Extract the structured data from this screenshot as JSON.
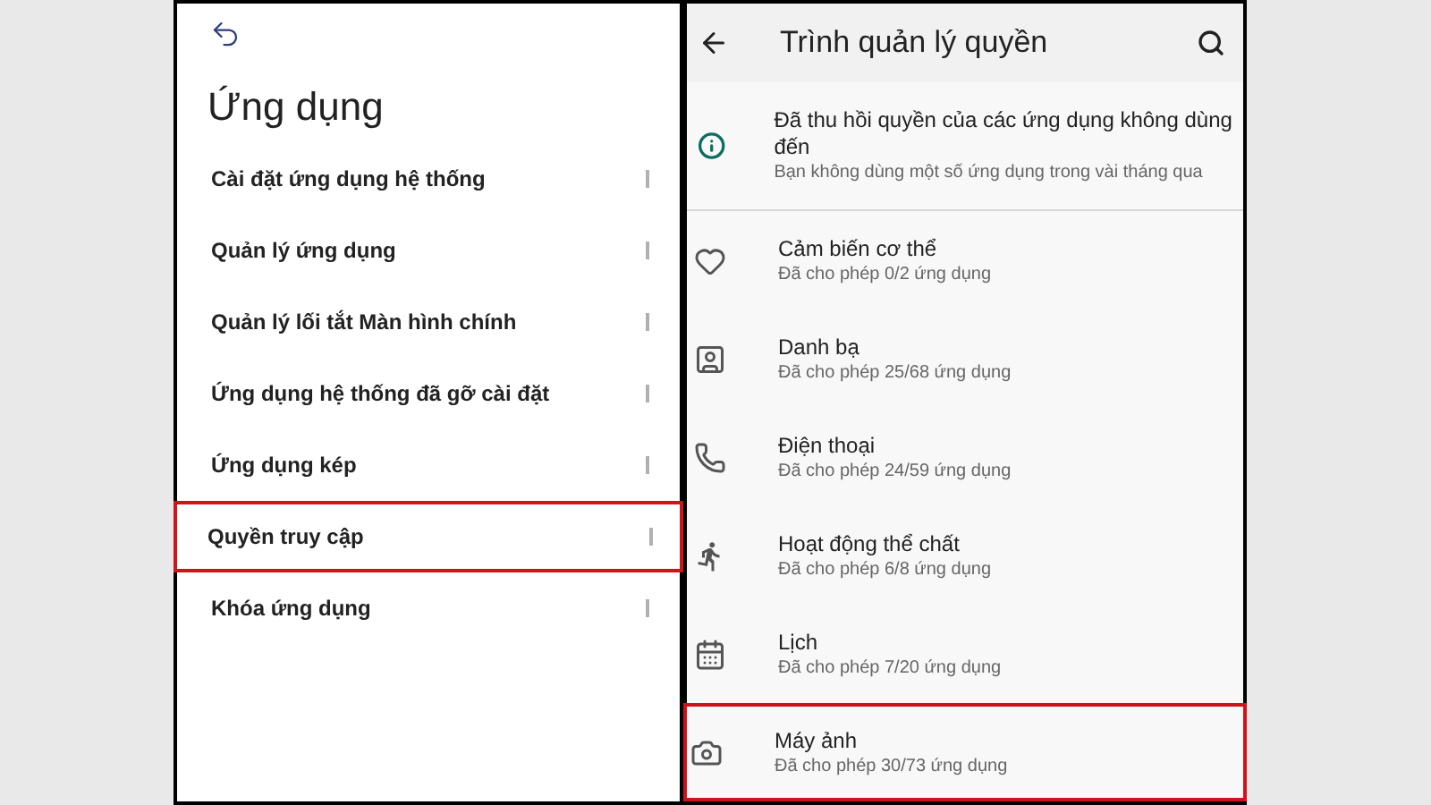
{
  "left_screen": {
    "title": "Ứng dụng",
    "items": [
      {
        "label": "Cài đặt ứng dụng hệ thống",
        "highlighted": false
      },
      {
        "label": "Quản lý ứng dụng",
        "highlighted": false
      },
      {
        "label": "Quản lý lối tắt Màn hình chính",
        "highlighted": false
      },
      {
        "label": "Ứng dụng hệ thống đã gỡ cài đặt",
        "highlighted": false
      },
      {
        "label": "Ứng dụng kép",
        "highlighted": false
      },
      {
        "label": "Quyền truy cập",
        "highlighted": true
      },
      {
        "label": "Khóa ứng dụng",
        "highlighted": false
      }
    ]
  },
  "right_screen": {
    "title": "Trình quản lý quyền",
    "notice": {
      "title": "Đã thu hồi quyền của các ứng dụng không dùng đến",
      "subtitle": "Bạn không dùng một số ứng dụng trong vài tháng qua"
    },
    "permissions": [
      {
        "kind": "body",
        "label": "Cảm biến cơ thể",
        "summary": "Đã cho phép 0/2 ứng dụng",
        "highlighted": false
      },
      {
        "kind": "contacts",
        "label": "Danh bạ",
        "summary": "Đã cho phép 25/68 ứng dụng",
        "highlighted": false
      },
      {
        "kind": "phone",
        "label": "Điện thoại",
        "summary": "Đã cho phép 24/59 ứng dụng",
        "highlighted": false
      },
      {
        "kind": "activity",
        "label": "Hoạt động thể chất",
        "summary": "Đã cho phép 6/8 ứng dụng",
        "highlighted": false
      },
      {
        "kind": "calendar",
        "label": "Lịch",
        "summary": "Đã cho phép 7/20 ứng dụng",
        "highlighted": false
      },
      {
        "kind": "camera",
        "label": "Máy ảnh",
        "summary": "Đã cho phép 30/73 ứng dụng",
        "highlighted": true
      }
    ]
  }
}
